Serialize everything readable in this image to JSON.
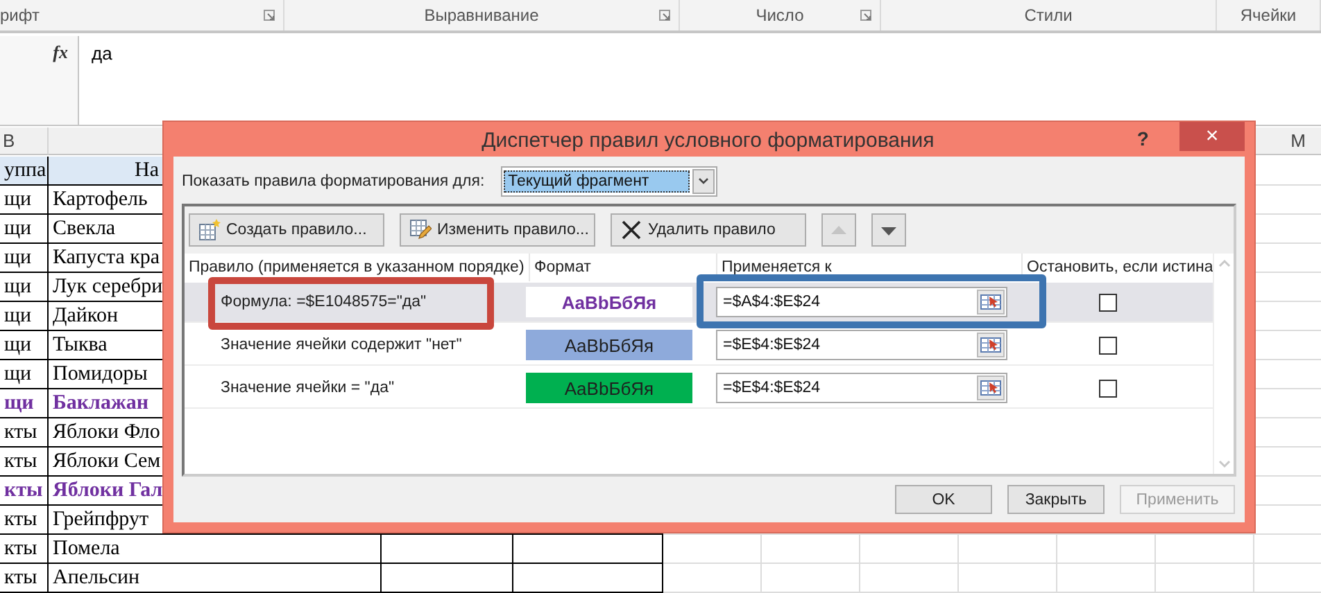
{
  "ribbon": {
    "groups": [
      {
        "label": "рифт",
        "launcher": true
      },
      {
        "label": "Выравнивание",
        "launcher": true
      },
      {
        "label": "Число",
        "launcher": true
      },
      {
        "label": "Стили",
        "launcher": false
      },
      {
        "label": "Ячейки",
        "launcher": false
      }
    ]
  },
  "formula_bar": {
    "fx": "fx",
    "value": "да"
  },
  "sheet": {
    "column_headers": [
      "B",
      "M"
    ],
    "rows": [
      {
        "cells": [
          "уппа",
          "На"
        ],
        "header": true,
        "emphasized": false
      },
      {
        "cells": [
          "щи",
          "Картофель"
        ],
        "header": false,
        "emphasized": false
      },
      {
        "cells": [
          "щи",
          "Свекла"
        ],
        "header": false,
        "emphasized": false
      },
      {
        "cells": [
          "щи",
          "Капуста кра"
        ],
        "header": false,
        "emphasized": false
      },
      {
        "cells": [
          "щи",
          "Лук серебри"
        ],
        "header": false,
        "emphasized": false
      },
      {
        "cells": [
          "щи",
          "Дайкон"
        ],
        "header": false,
        "emphasized": false
      },
      {
        "cells": [
          "щи",
          "Тыква"
        ],
        "header": false,
        "emphasized": false
      },
      {
        "cells": [
          "щи",
          "Помидоры"
        ],
        "header": false,
        "emphasized": false
      },
      {
        "cells": [
          "щи",
          "Баклажан"
        ],
        "header": false,
        "emphasized": true
      },
      {
        "cells": [
          "кты",
          "Яблоки Фло"
        ],
        "header": false,
        "emphasized": false
      },
      {
        "cells": [
          "кты",
          "Яблоки Сем"
        ],
        "header": false,
        "emphasized": false
      },
      {
        "cells": [
          "кты",
          "Яблоки Гал"
        ],
        "header": false,
        "emphasized": true
      },
      {
        "cells": [
          "кты",
          "Грейпфрут"
        ],
        "header": false,
        "emphasized": false
      },
      {
        "cells": [
          "кты",
          "Помела"
        ],
        "header": false,
        "emphasized": false
      },
      {
        "cells": [
          "кты",
          "Апельсин"
        ],
        "header": false,
        "emphasized": false
      }
    ]
  },
  "dialog": {
    "title": "Диспетчер правил условного форматирования",
    "help": "?",
    "close": "×",
    "scope_label": "Показать правила форматирования для:",
    "scope_value": "Текущий фрагмент",
    "toolbar": [
      {
        "kind": "new",
        "label": "Создать правило..."
      },
      {
        "kind": "edit",
        "label": "Изменить правило..."
      },
      {
        "kind": "delete",
        "label": "Удалить правило"
      },
      {
        "kind": "up",
        "disabled": true
      },
      {
        "kind": "down",
        "disabled": false
      }
    ],
    "columns": [
      "Правило (применяется в указанном порядке)",
      "Формат",
      "Применяется к",
      "Остановить, если истина"
    ],
    "rules": [
      {
        "rule": "Формула: =$E1048575=\"да\"",
        "preview": "AaBbБбЯя",
        "kind": "font",
        "color": "#7030a0",
        "applies_to": "=$A$4:$E$24",
        "stop_if_true": false,
        "selected": true,
        "rule_marked": true,
        "applies_marked": true
      },
      {
        "rule": "Значение ячейки содержит \"нет\"",
        "preview": "AaBbБбЯя",
        "kind": "fill",
        "color": "#8eaadb",
        "applies_to": "=$E$4:$E$24",
        "stop_if_true": false,
        "selected": false,
        "rule_marked": false,
        "applies_marked": false
      },
      {
        "rule": "Значение ячейки = \"да\"",
        "preview": "AaBbБбЯя",
        "kind": "fill",
        "color": "#00b050",
        "applies_to": "=$E$4:$E$24",
        "stop_if_true": false,
        "selected": false,
        "rule_marked": false,
        "applies_marked": false
      }
    ],
    "footer": [
      {
        "label": "OK",
        "disabled": false
      },
      {
        "label": "Закрыть",
        "disabled": false
      },
      {
        "label": "Применить",
        "disabled": true
      }
    ]
  }
}
